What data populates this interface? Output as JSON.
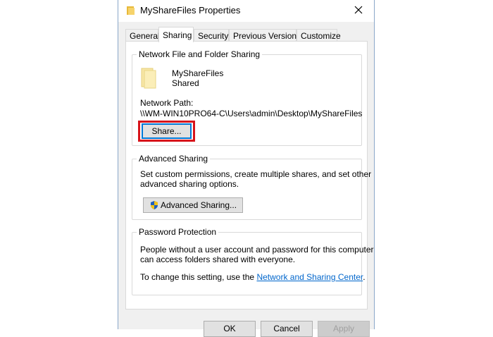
{
  "window": {
    "title": "MyShareFiles Properties",
    "close_glyph": "✕"
  },
  "tabs": [
    {
      "label": "General"
    },
    {
      "label": "Sharing",
      "active": true
    },
    {
      "label": "Security"
    },
    {
      "label": "Previous Versions"
    },
    {
      "label": "Customize"
    }
  ],
  "network_sharing": {
    "title": "Network File and Folder Sharing",
    "folder_name": "MyShareFiles",
    "folder_status": "Shared",
    "path_label": "Network Path:",
    "path_value": "\\\\WM-WIN10PRO64-C\\Users\\admin\\Desktop\\MyShareFiles",
    "share_button": "Share...",
    "highlight_color": "#d7141b"
  },
  "advanced_sharing": {
    "title": "Advanced Sharing",
    "description_line1": "Set custom permissions, create multiple shares, and set other",
    "description_line2": "advanced sharing options.",
    "button": "Advanced Sharing..."
  },
  "password_protection": {
    "title": "Password Protection",
    "description_line1": "People without a user account and password for this computer",
    "description_line2": "can access folders shared with everyone.",
    "change_prefix": "To change this setting, use the ",
    "link_text": "Network and Sharing Center",
    "change_suffix": "."
  },
  "footer": {
    "ok": "OK",
    "cancel": "Cancel",
    "apply": "Apply"
  },
  "colors": {
    "link": "#0066cc",
    "accent": "#0078d7",
    "folder": "#f4c542"
  }
}
